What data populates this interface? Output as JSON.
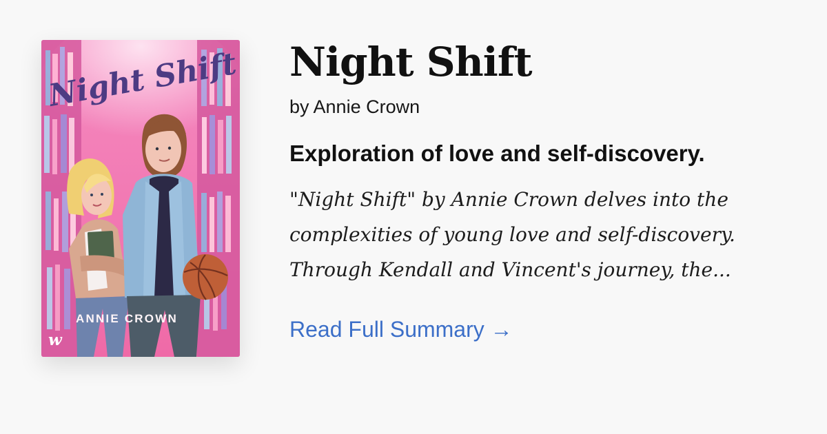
{
  "book": {
    "title": "Night Shift",
    "author_line": "by Annie Crown",
    "tagline": "Exploration of love and self-discovery.",
    "summary_excerpt": "\"Night Shift\" by Annie Crown delves into the complexities of young love and self-discovery. Through Kendall and Vincent's journey, the...",
    "read_more_label": "Read Full Summary →"
  },
  "cover": {
    "title_text": "Night Shift",
    "author_text": "ANNIE CROWN",
    "publisher_mark": "w",
    "colors": {
      "background": "#f06aaa",
      "shelves": "#d65a9f",
      "title": "#4d3b83",
      "jacket": "#8fb5d6",
      "cardigan": "#d9a890"
    }
  },
  "colors": {
    "page_background": "#f8f8f8",
    "link": "#3c6fc8"
  }
}
